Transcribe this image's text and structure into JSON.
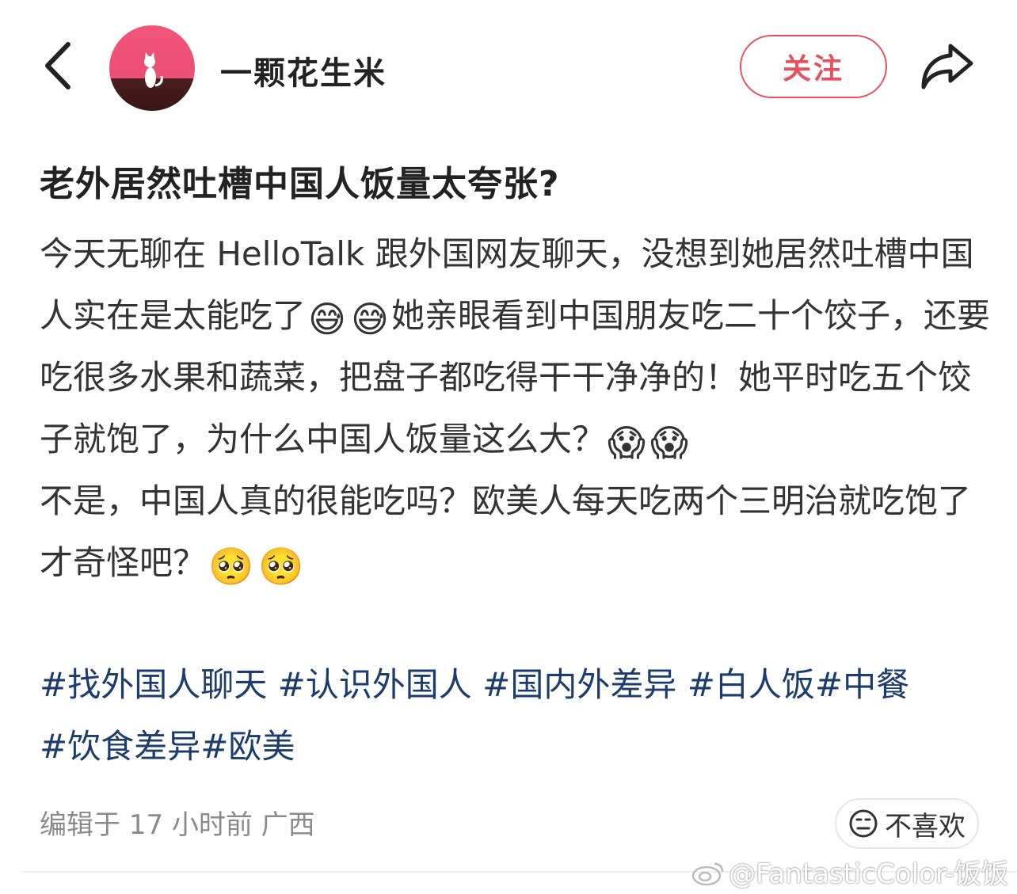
{
  "header": {
    "username": "一颗花生米",
    "follow_label": "关注"
  },
  "post": {
    "title": "老外居然吐槽中国人饭量太夸张?",
    "paragraph1": {
      "a": "今天无聊在 HelloTalk 跟外国网友聊天，没想到她居然吐槽中国人实在是太能吃了",
      "emoji1": "😅",
      "emoji2": "😅",
      "b": "她亲眼看到中国朋友吃二十个饺子，还要吃很多水果和蔬菜，把盘子都吃得干干净净的！她平时吃五个饺子就饱了，为什么中国人饭量这么大？",
      "emoji3": "😱",
      "emoji4": "😱"
    },
    "paragraph2": {
      "a": "不是，中国人真的很能吃吗？欧美人每天吃两个三明治就吃饱了才奇怪吧？",
      "emoji1": "🥺",
      "emoji2": "🥺"
    },
    "tags": [
      "#找外国人聊天",
      "#认识外国人",
      "#国内外差异",
      "#白人饭",
      "#中餐",
      "#饮食差异",
      "#欧美"
    ]
  },
  "footer": {
    "meta": "编辑于 17 小时前 广西",
    "dislike_label": "不喜欢"
  },
  "watermark": "@FantasticColor-饭饭",
  "colors": {
    "accent": "#e8505b",
    "tag": "#1d3c6e",
    "meta": "#8a8a8a"
  }
}
